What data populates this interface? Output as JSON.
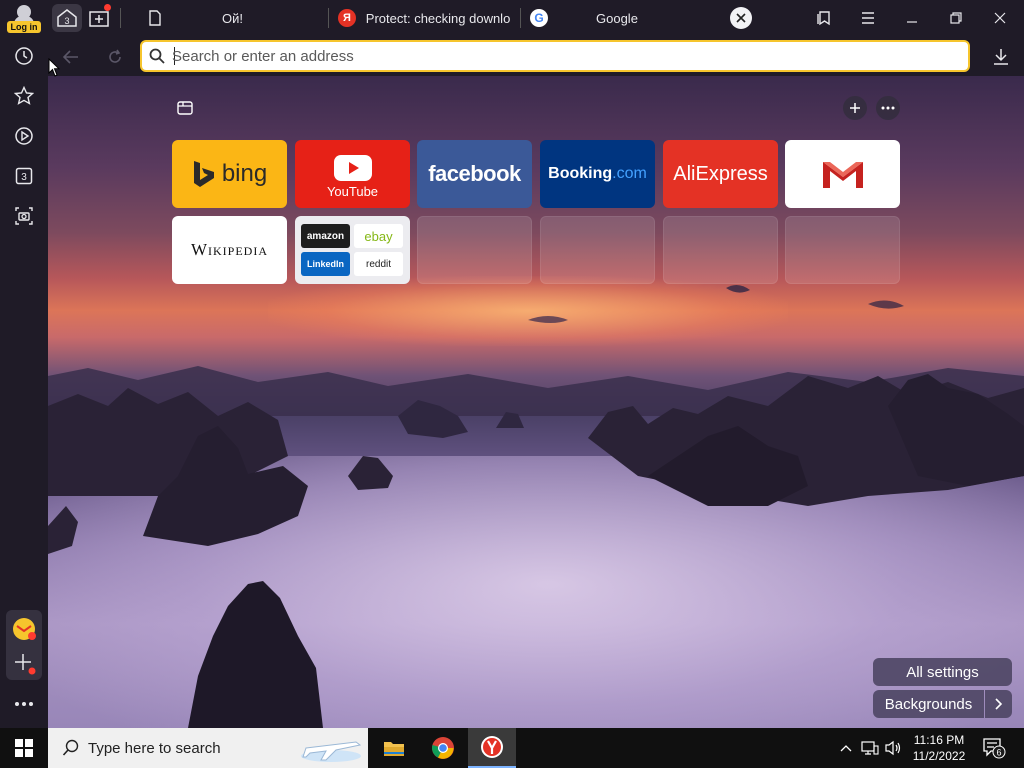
{
  "titlebar": {
    "login_badge": "Log in",
    "tab_count": "3",
    "tabs": [
      {
        "title": "Ой!"
      },
      {
        "title": "Protect: checking downlo"
      },
      {
        "title": "Google"
      }
    ]
  },
  "toolbar": {
    "search_placeholder": "Search or enter an address"
  },
  "sidebar": {
    "collections_count": "3"
  },
  "dashboard": {
    "tiles": [
      {
        "label": "bing"
      },
      {
        "label": "YouTube"
      },
      {
        "label": "facebook"
      },
      {
        "label": "Booking",
        "suffix": ".com"
      },
      {
        "label": "AliExpress"
      },
      {
        "label": "M"
      },
      {
        "label": "Wikipedia"
      },
      {
        "group": [
          "amazon",
          "ebay",
          "LinkedIn",
          "reddit"
        ]
      }
    ],
    "all_settings_label": "All settings",
    "backgrounds_label": "Backgrounds"
  },
  "taskbar": {
    "search_placeholder": "Type here to search",
    "time": "11:16 PM",
    "date": "11/2/2022",
    "notification_count": "6"
  },
  "colors": {
    "accent": "#f6c52d",
    "bing": "#fbb615",
    "youtube": "#e62117",
    "facebook": "#3b5998",
    "booking": "#003580",
    "aliexpress": "#e43225",
    "gmail_red": "#c5221f"
  }
}
